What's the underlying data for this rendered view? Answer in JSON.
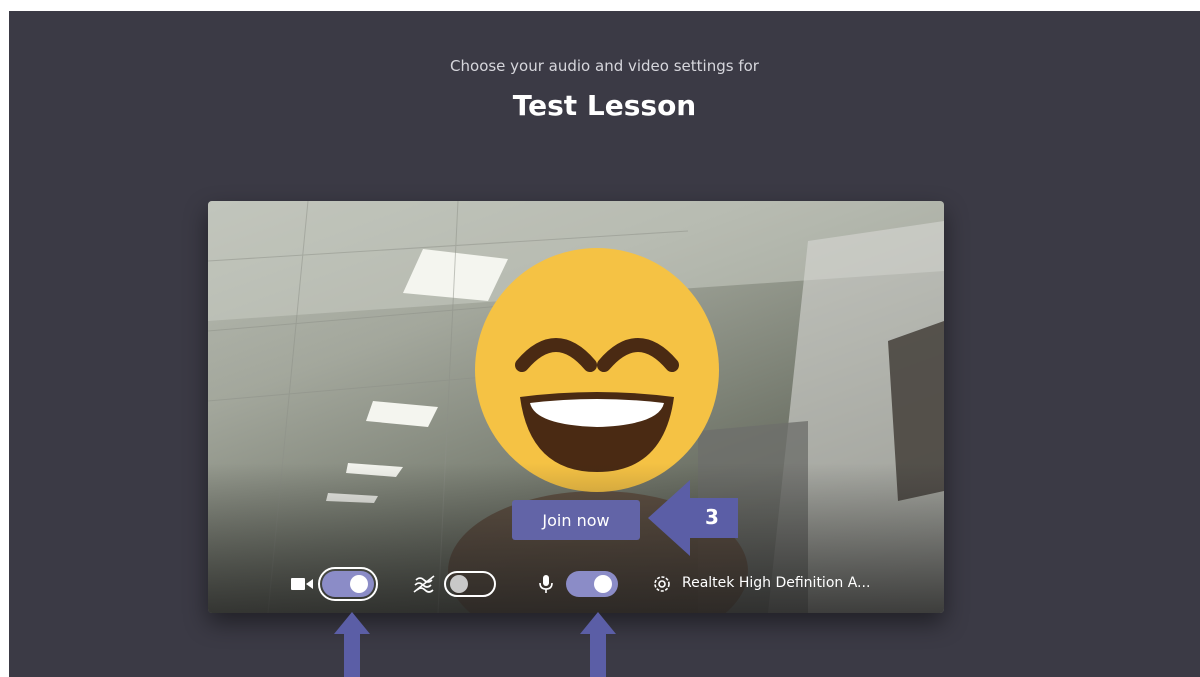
{
  "header": {
    "subtitle": "Choose your audio and video settings for",
    "meeting_title": "Test Lesson"
  },
  "preview": {
    "join_button": "Join now"
  },
  "controls": {
    "camera_toggle_on": true,
    "background_blur_toggle_on": false,
    "microphone_toggle_on": true,
    "audio_device": "Realtek High Definition A..."
  },
  "annotations": {
    "step_label": "3"
  },
  "colors": {
    "app_background": "#3b3a45",
    "accent": "#6264a7",
    "toggle_on": "#8b8cc7",
    "annotation_arrow": "#5b5ea6",
    "emoji_face": "#f5c244"
  },
  "icons": [
    "camera-icon",
    "background-blur-icon",
    "microphone-icon",
    "gear-icon"
  ]
}
